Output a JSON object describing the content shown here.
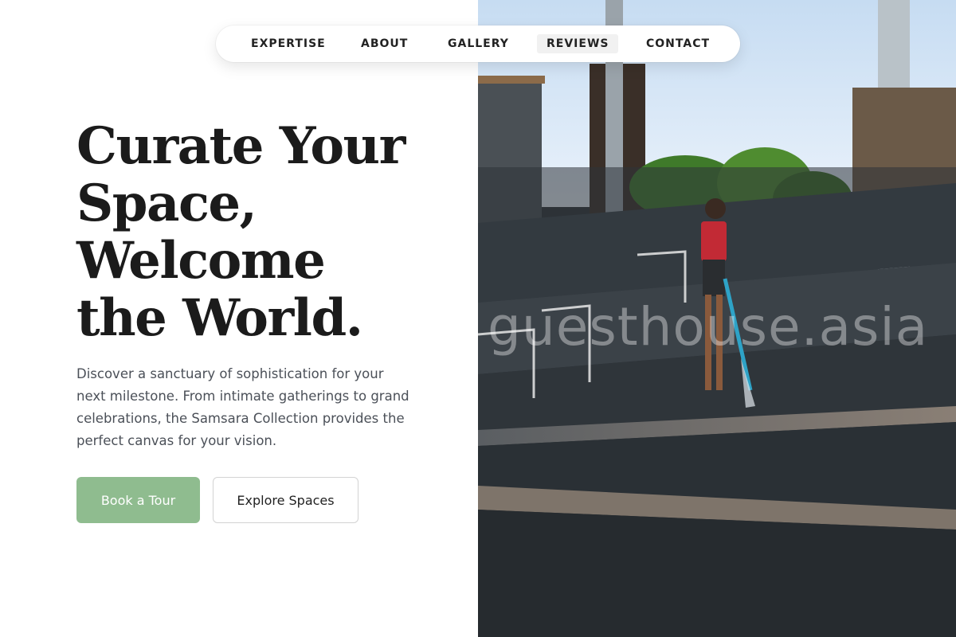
{
  "nav": {
    "items": [
      {
        "label": "EXPERTISE"
      },
      {
        "label": "ABOUT"
      },
      {
        "label": "GALLERY"
      },
      {
        "label": "REVIEWS"
      },
      {
        "label": "CONTACT"
      }
    ],
    "active": "REVIEWS"
  },
  "hero": {
    "headline_lines": [
      "Curate Your",
      "Space,",
      "Welcome",
      "the World."
    ],
    "description": "Discover a sanctuary of sophistication for your next milestone. From intimate gatherings to grand celebrations, the Samsara Collection provides the perfect canvas for your vision.",
    "primary_cta": "Book a Tour",
    "secondary_cta": "Explore Spaces"
  },
  "photo": {
    "watermark": "guesthouse.asia",
    "alt": "Worker pressure-washing concrete stadium steps"
  },
  "colors": {
    "accent": "#8fbc8f",
    "headline": "#1b1b1b",
    "body_text": "#4b5058"
  }
}
